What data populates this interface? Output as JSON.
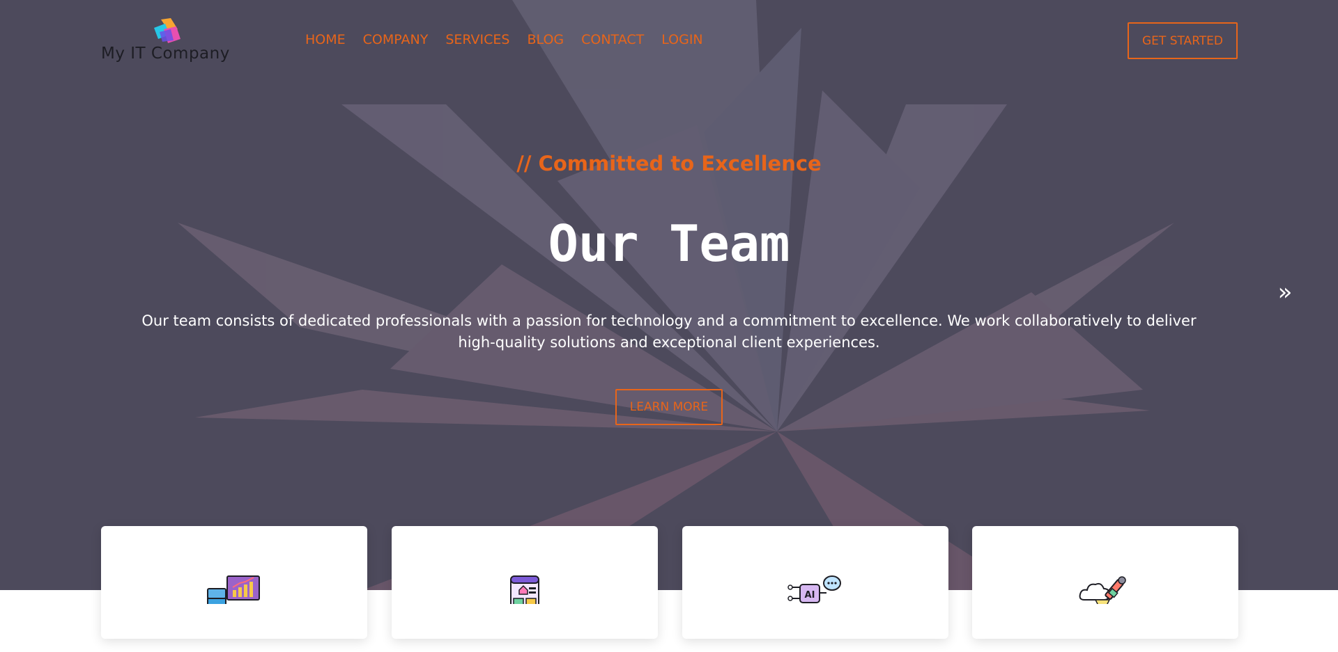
{
  "brand": {
    "name": "My IT Company"
  },
  "nav": {
    "items": [
      {
        "label": "HOME"
      },
      {
        "label": "COMPANY"
      },
      {
        "label": "SERVICES"
      },
      {
        "label": "BLOG"
      },
      {
        "label": "CONTACT"
      },
      {
        "label": "LOGIN"
      }
    ],
    "cta_label": "GET STARTED"
  },
  "hero": {
    "tagline": "// Committed to Excellence",
    "title": "Our Team",
    "description": "Our team consists of dedicated professionals with a passion for technology and a commitment to excellence. We work collaboratively to deliver high-quality solutions and exceptional client experiences.",
    "button_label": "LEARN MORE",
    "next_icon": "double-chevron-right-icon"
  },
  "cards": [
    {
      "icon": "analytics-dashboard-icon"
    },
    {
      "icon": "mobile-app-icon"
    },
    {
      "icon": "ai-chip-icon"
    },
    {
      "icon": "cloud-design-icon"
    }
  ],
  "colors": {
    "accent": "#e8651a",
    "hero_overlay": "#4d4a5c",
    "text_light": "#ffffff",
    "logo_text": "#1d1d24"
  }
}
